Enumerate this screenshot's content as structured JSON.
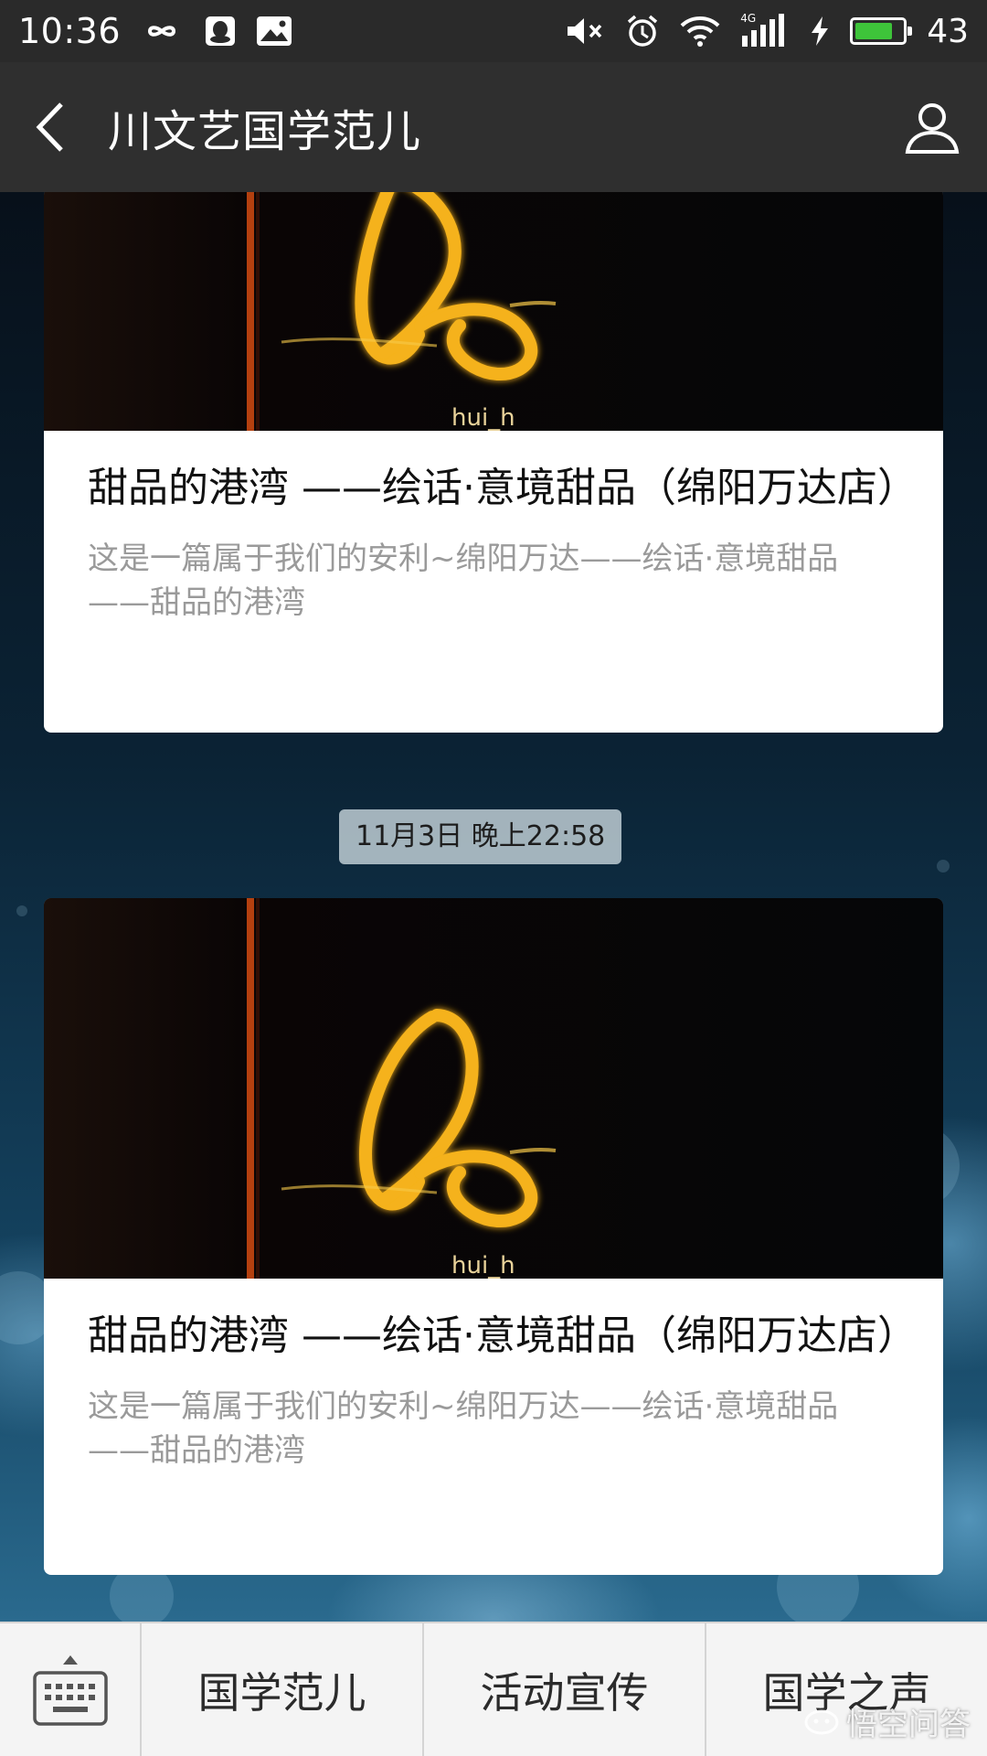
{
  "status_bar": {
    "time": "10:36",
    "battery_percent": "43",
    "network": "4G",
    "battery_level": 0.8,
    "colors": {
      "battery_fill": "#3ec43a"
    }
  },
  "header": {
    "title": "川文艺国学范儿"
  },
  "messages": [
    {
      "article": {
        "title": "甜品的港湾 ——绘话·意境甜品（绵阳万达店）",
        "description": "这是一篇属于我们的安利~绵阳万达——绘话·意境甜品——甜品的港湾",
        "cover_caption": "hui_h"
      }
    },
    {
      "timestamp": "11月3日 晚上22:58",
      "article": {
        "title": "甜品的港湾 ——绘话·意境甜品（绵阳万达店）",
        "description": "这是一篇属于我们的安利~绵阳万达——绘话·意境甜品——甜品的港湾",
        "cover_caption": "hui_h"
      }
    }
  ],
  "bottom_menu": {
    "items": [
      {
        "label": "国学范儿"
      },
      {
        "label": "活动宣传"
      },
      {
        "label": "国学之声"
      }
    ]
  },
  "watermark": {
    "text": "悟空问答"
  },
  "icons": {
    "back": "chevron-left-icon",
    "profile": "person-icon",
    "keyboard": "keyboard-icon"
  }
}
